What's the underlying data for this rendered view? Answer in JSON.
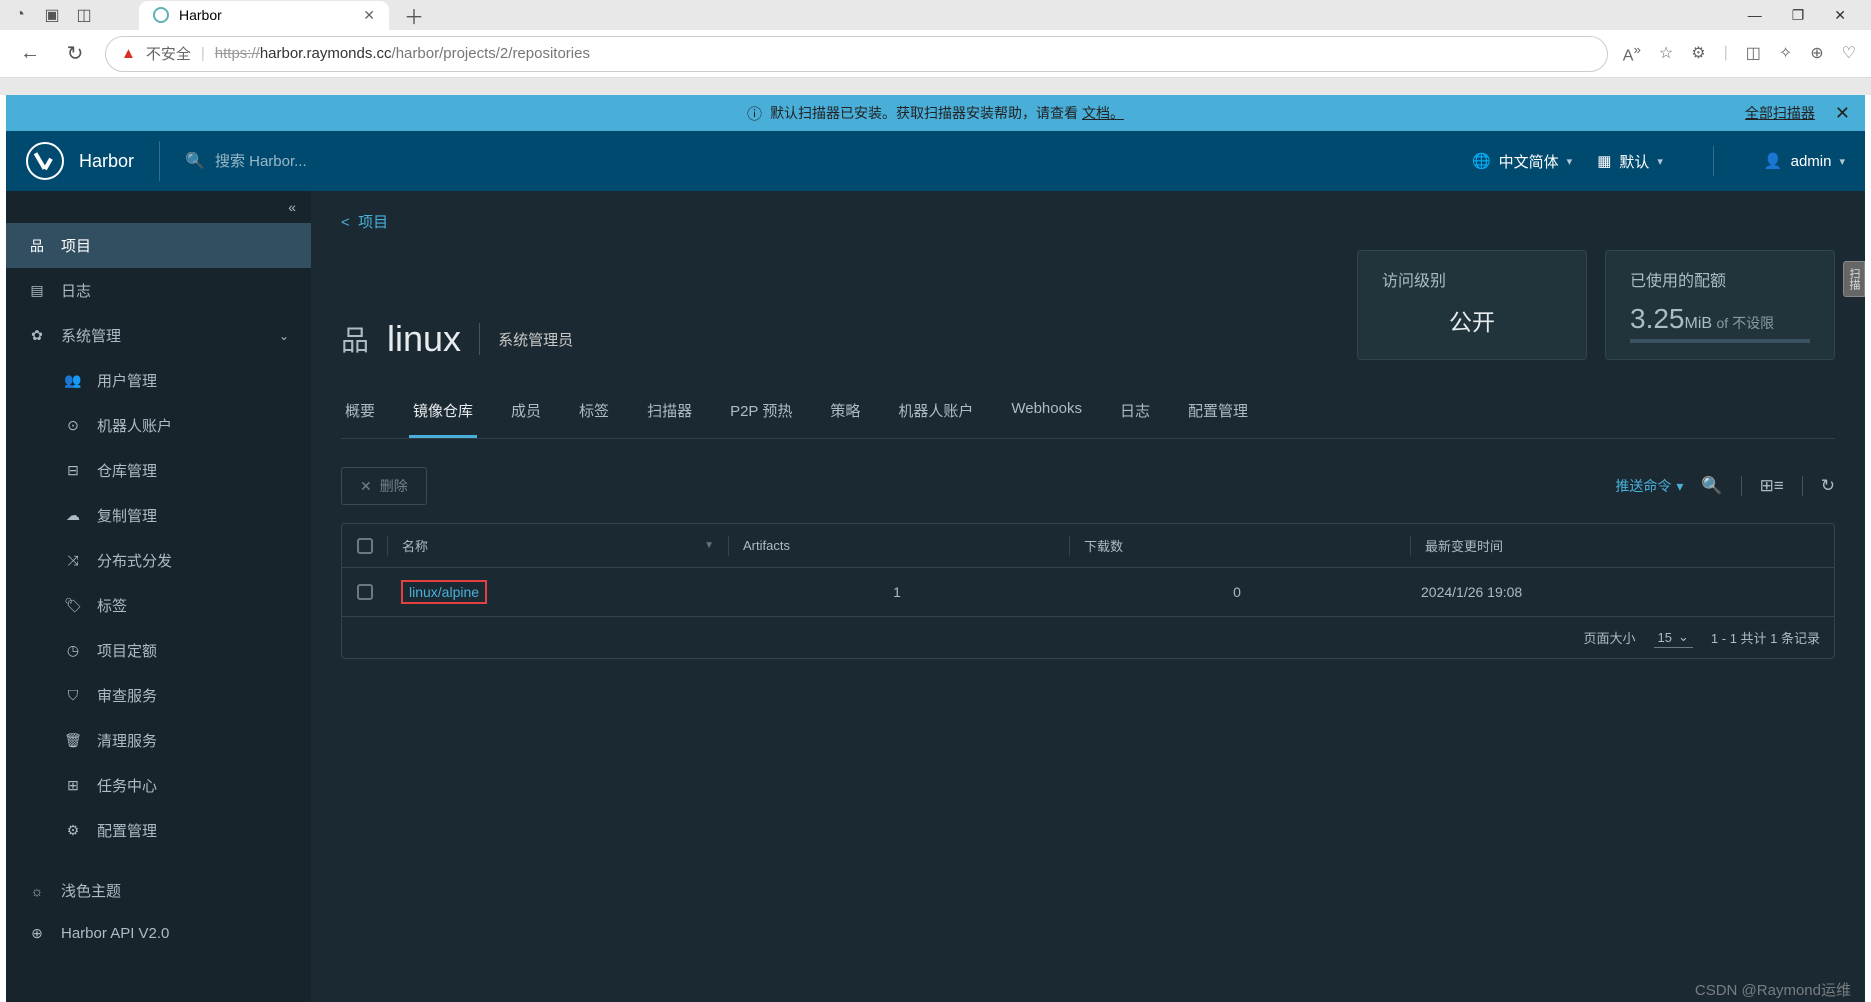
{
  "browser": {
    "tab_title": "Harbor",
    "url_scheme": "https://",
    "url_host": "harbor.raymonds.cc",
    "url_path": "/harbor/projects/2/repositories",
    "insecure_label": "不安全"
  },
  "banner": {
    "message_pre": "默认扫描器已安装。获取扫描器安装帮助，请查看 ",
    "doc_link": "文档。",
    "all_scanners": "全部扫描器"
  },
  "header": {
    "brand": "Harbor",
    "search_placeholder": "搜索 Harbor...",
    "language": "中文简体",
    "theme": "默认",
    "user": "admin"
  },
  "sidebar": {
    "items": [
      {
        "icon": "sitemap",
        "label": "项目",
        "active": true
      },
      {
        "icon": "book",
        "label": "日志"
      },
      {
        "icon": "cog",
        "label": "系统管理",
        "expandable": true
      },
      {
        "icon": "users",
        "label": "用户管理",
        "sub": true
      },
      {
        "icon": "robot",
        "label": "机器人账户",
        "sub": true
      },
      {
        "icon": "database",
        "label": "仓库管理",
        "sub": true
      },
      {
        "icon": "cloud",
        "label": "复制管理",
        "sub": true
      },
      {
        "icon": "share",
        "label": "分布式分发",
        "sub": true
      },
      {
        "icon": "tag",
        "label": "标签",
        "sub": true
      },
      {
        "icon": "gauge",
        "label": "项目定额",
        "sub": true
      },
      {
        "icon": "shield",
        "label": "审查服务",
        "sub": true
      },
      {
        "icon": "trash",
        "label": "清理服务",
        "sub": true
      },
      {
        "icon": "tasks",
        "label": "任务中心",
        "sub": true
      },
      {
        "icon": "gear",
        "label": "配置管理",
        "sub": true
      }
    ],
    "light_theme": "浅色主题",
    "api_link": "Harbor API V2.0"
  },
  "main": {
    "back_label": "项目",
    "project_name": "linux",
    "project_role": "系统管理员",
    "stats": {
      "access_label": "访问级别",
      "access_value": "公开",
      "quota_label": "已使用的配额",
      "quota_value": "3.25",
      "quota_unit": "MiB",
      "quota_of": "of",
      "quota_limit": "不设限"
    },
    "tabs": [
      "概要",
      "镜像仓库",
      "成员",
      "标签",
      "扫描器",
      "P2P 预热",
      "策略",
      "机器人账户",
      "Webhooks",
      "日志",
      "配置管理"
    ],
    "active_tab": 1,
    "delete_button": "删除",
    "push_command": "推送命令",
    "columns": {
      "name": "名称",
      "artifacts": "Artifacts",
      "pulls": "下载数",
      "last_modified": "最新变更时间"
    },
    "rows": [
      {
        "name": "linux/alpine",
        "artifacts": "1",
        "pulls": "0",
        "time": "2024/1/26 19:08"
      }
    ],
    "footer": {
      "page_size_label": "页面大小",
      "page_size": "15",
      "record_text": "1 - 1 共计 1 条记录"
    }
  },
  "watermark": "CSDN @Raymond运维"
}
